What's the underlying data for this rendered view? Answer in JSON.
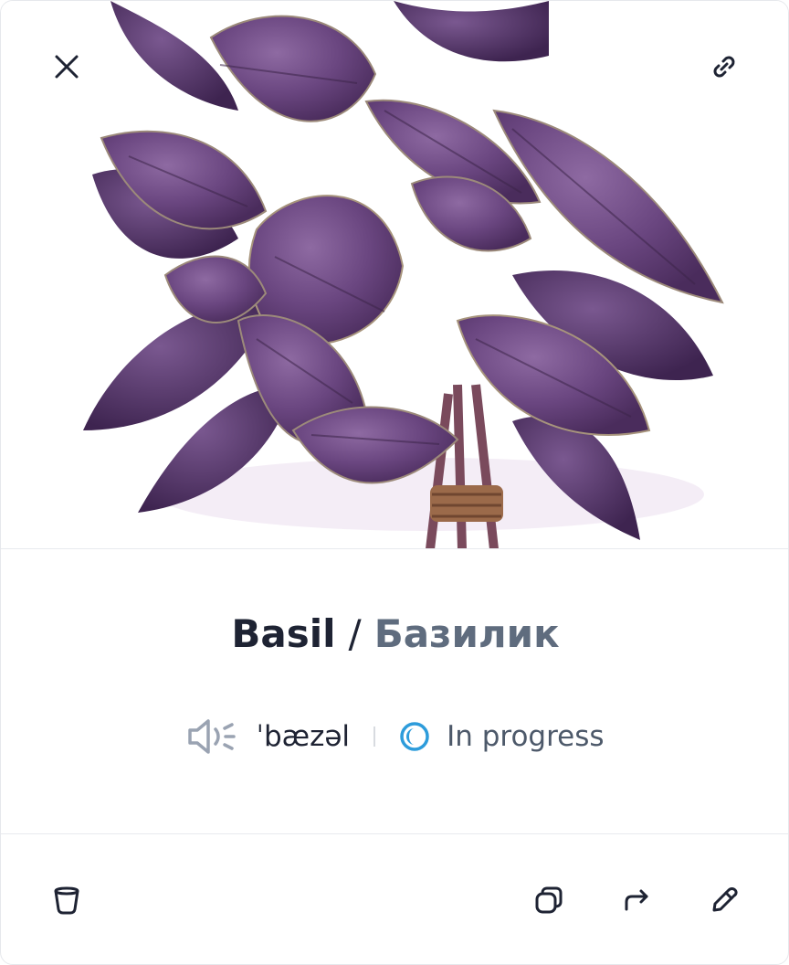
{
  "card": {
    "image_alt": "purple basil leaves",
    "word": "Basil",
    "separator": "/",
    "translation": "Базилик",
    "phonetic": "ˈbæzəl",
    "status": "In progress"
  },
  "icons": {
    "close": "close-icon",
    "link": "link-icon",
    "speaker": "speaker-icon",
    "status": "in-progress-icon",
    "delete": "trash-icon",
    "copy": "copy-icon",
    "share": "share-arrow-icon",
    "edit": "pencil-icon"
  },
  "colors": {
    "title": "#1e2333",
    "translation": "#5f6c7e",
    "status_accent": "#2d9cdb",
    "leaf_dark": "#4e2f5e",
    "leaf_mid": "#6e4a82",
    "leaf_light": "#8b6a9c"
  }
}
